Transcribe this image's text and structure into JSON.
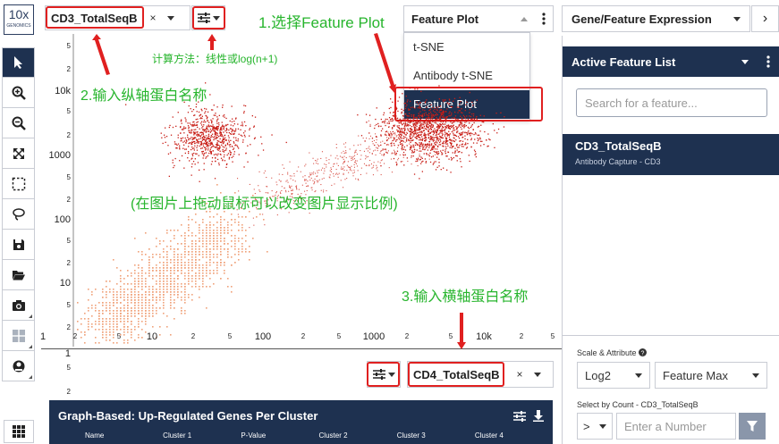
{
  "logo": {
    "main": "10x",
    "sub": "GENOMICS"
  },
  "y_selector": {
    "value": "CD3_TotalSeqB",
    "clear": "×"
  },
  "x_selector": {
    "value": "CD4_TotalSeqB",
    "clear": "×"
  },
  "plot_selector": {
    "value": "Feature Plot",
    "options": [
      "t-SNE",
      "Antibody t-SNE",
      "Feature Plot"
    ]
  },
  "gene_feature": {
    "value": "Gene/Feature Expression",
    "next": "›"
  },
  "active_list": {
    "title": "Active Feature List",
    "search_placeholder": "Search for a feature...",
    "item_title": "CD3_TotalSeqB",
    "item_sub": "Antibody Capture - CD3"
  },
  "scale": {
    "label": "Scale & Attribute",
    "scale_value": "Log2",
    "attr_value": "Feature Max"
  },
  "count": {
    "label": "Select by Count - CD3_TotalSeqB",
    "op": ">",
    "placeholder": "Enter a Number"
  },
  "table": {
    "title": "Graph-Based: Up-Regulated Genes Per Cluster",
    "columns": [
      "Name",
      "Cluster 1",
      "P-Value",
      "Cluster 2",
      "Cluster 3",
      "Cluster 4"
    ]
  },
  "annotations": {
    "step1": "1.选择Feature Plot",
    "step2": "2.输入纵轴蛋白名称",
    "step3": "3.输入横轴蛋白名称",
    "method": "计算方法：线性或log(n+1)",
    "zoom": "(在图片上拖动鼠标可以改变图片显示比例)"
  },
  "colors": {
    "navy": "#1e3150",
    "red": "#e02020",
    "green": "#27b52d",
    "dot_dark": "#c81d16",
    "dot_light": "#f0a27a"
  },
  "y_ticks": [
    {
      "label": "5",
      "small": true
    },
    {
      "label": "2",
      "small": true
    },
    {
      "label": "10k"
    },
    {
      "label": "5",
      "small": true
    },
    {
      "label": "2",
      "small": true
    },
    {
      "label": "1000"
    },
    {
      "label": "5",
      "small": true
    },
    {
      "label": "2",
      "small": true
    },
    {
      "label": "100"
    },
    {
      "label": "5",
      "small": true
    },
    {
      "label": "2",
      "small": true
    },
    {
      "label": "10"
    },
    {
      "label": "5",
      "small": true
    },
    {
      "label": "2",
      "small": true
    }
  ],
  "y_ticks_bottom": [
    {
      "label": "1"
    },
    {
      "label": "5",
      "small": true
    },
    {
      "label": "2",
      "small": true
    }
  ],
  "x_ticks": [
    {
      "label": "1"
    },
    {
      "label": "2",
      "small": true
    },
    {
      "label": "5",
      "small": true
    },
    {
      "label": "10"
    },
    {
      "label": "2",
      "small": true
    },
    {
      "label": "5",
      "small": true
    },
    {
      "label": "100"
    },
    {
      "label": "2",
      "small": true
    },
    {
      "label": "5",
      "small": true
    },
    {
      "label": "1000"
    },
    {
      "label": "2",
      "small": true
    },
    {
      "label": "5",
      "small": true
    },
    {
      "label": "10k"
    },
    {
      "label": "2",
      "small": true
    },
    {
      "label": "5",
      "small": true
    }
  ]
}
